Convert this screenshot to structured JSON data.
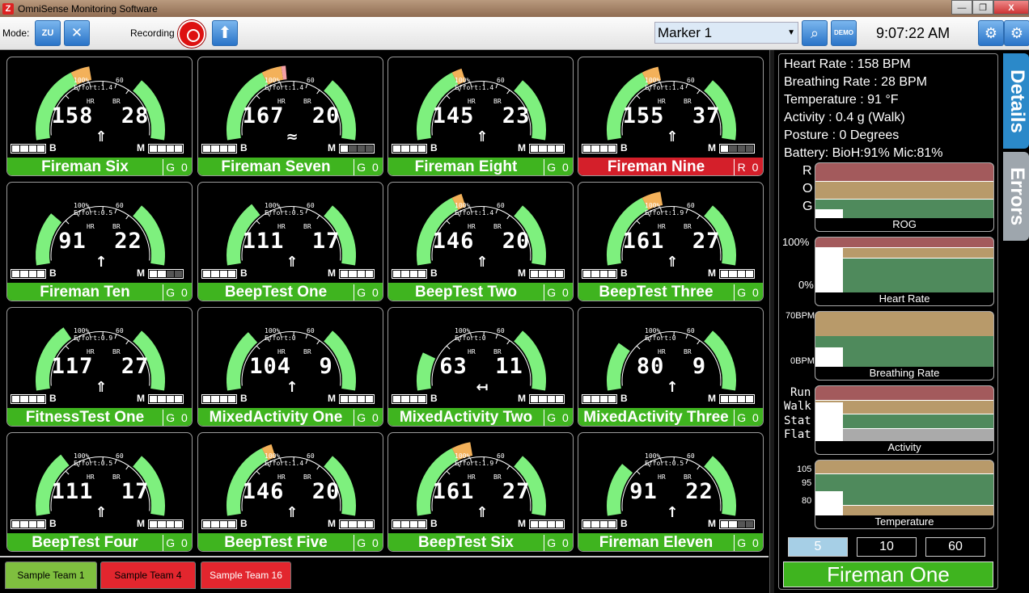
{
  "window": {
    "title": "OmniSense Monitoring Software",
    "buttons": [
      "—",
      "❐",
      "X"
    ]
  },
  "toolbar": {
    "mode_label": "Mode:",
    "recording_label": "Recording",
    "marker": "Marker 1",
    "clock": "9:07:22 AM",
    "demo_label": "DEMO",
    "mode_icon_label": "ZU"
  },
  "cards": [
    {
      "name": "Fireman Six",
      "hr": "158",
      "br": "28",
      "effort": "Effort:1.4",
      "status": "G 0",
      "footer": "green",
      "bio_batt": 4,
      "mic_batt": 4,
      "hr_level": 0.9,
      "activity": "walk"
    },
    {
      "name": "Fireman Seven",
      "hr": "167",
      "br": "20",
      "effort": "Effort:1.4",
      "status": "G 0",
      "footer": "green",
      "bio_batt": 4,
      "mic_batt": 1,
      "hr_level": 0.95,
      "activity": "run"
    },
    {
      "name": "Fireman Eight",
      "hr": "145",
      "br": "23",
      "effort": "Effort:1.4",
      "status": "G 0",
      "footer": "green",
      "bio_batt": 4,
      "mic_batt": 4,
      "hr_level": 0.82,
      "activity": "walk"
    },
    {
      "name": "Fireman Nine",
      "hr": "155",
      "br": "37",
      "effort": "Effort:1.4",
      "status": "R 0",
      "footer": "red",
      "bio_batt": 4,
      "mic_batt": 1,
      "hr_level": 0.88,
      "activity": "walk"
    },
    {
      "name": "Fireman Ten",
      "hr": "91",
      "br": "22",
      "effort": "Effort:0.5",
      "status": "G 0",
      "footer": "green",
      "bio_batt": 4,
      "mic_batt": 2,
      "hr_level": 0.5,
      "activity": "stand"
    },
    {
      "name": "BeepTest One",
      "hr": "111",
      "br": "17",
      "effort": "Effort:0.5",
      "status": "G 0",
      "footer": "green",
      "bio_batt": 4,
      "mic_batt": 4,
      "hr_level": 0.62,
      "activity": "walk"
    },
    {
      "name": "BeepTest Two",
      "hr": "146",
      "br": "20",
      "effort": "Effort:1.4",
      "status": "G 0",
      "footer": "green",
      "bio_batt": 4,
      "mic_batt": 4,
      "hr_level": 0.82,
      "activity": "walk"
    },
    {
      "name": "BeepTest Three",
      "hr": "161",
      "br": "27",
      "effort": "Effort:1.9",
      "status": "G 0",
      "footer": "green",
      "bio_batt": 4,
      "mic_batt": 4,
      "hr_level": 0.9,
      "activity": "walk"
    },
    {
      "name": "FitnessTest One",
      "hr": "117",
      "br": "27",
      "effort": "Effort:0.9",
      "status": "G 0",
      "footer": "green",
      "bio_batt": 4,
      "mic_batt": 4,
      "hr_level": 0.65,
      "activity": "walk"
    },
    {
      "name": "MixedActivity One",
      "hr": "104",
      "br": "9",
      "effort": "Effort:0",
      "status": "G 0",
      "footer": "green",
      "bio_batt": 4,
      "mic_batt": 4,
      "hr_level": 0.58,
      "activity": "stand"
    },
    {
      "name": "MixedActivity Two",
      "hr": "63",
      "br": "11",
      "effort": "Effort:0",
      "status": "G 0",
      "footer": "green",
      "bio_batt": 4,
      "mic_batt": 4,
      "hr_level": 0.35,
      "activity": "lie"
    },
    {
      "name": "MixedActivity Three",
      "hr": "80",
      "br": "9",
      "effort": "Effort:0",
      "status": "G 0",
      "footer": "green",
      "bio_batt": 4,
      "mic_batt": 4,
      "hr_level": 0.45,
      "activity": "stand"
    },
    {
      "name": "BeepTest Four",
      "hr": "111",
      "br": "17",
      "effort": "Effort:0.5",
      "status": "G 0",
      "footer": "green",
      "bio_batt": 4,
      "mic_batt": 4,
      "hr_level": 0.62,
      "activity": "walk"
    },
    {
      "name": "BeepTest Five",
      "hr": "146",
      "br": "20",
      "effort": "Effort:1.4",
      "status": "G 0",
      "footer": "green",
      "bio_batt": 4,
      "mic_batt": 4,
      "hr_level": 0.82,
      "activity": "walk"
    },
    {
      "name": "BeepTest Six",
      "hr": "161",
      "br": "27",
      "effort": "Effort:1.9",
      "status": "G 0",
      "footer": "green",
      "bio_batt": 4,
      "mic_batt": 4,
      "hr_level": 0.9,
      "activity": "walk"
    },
    {
      "name": "Fireman Eleven",
      "hr": "91",
      "br": "22",
      "effort": "Effort:0.5",
      "status": "G 0",
      "footer": "green",
      "bio_batt": 4,
      "mic_batt": 2,
      "hr_level": 0.5,
      "activity": "stand"
    }
  ],
  "gauge_labels": {
    "pct": "100%",
    "br_max": "60",
    "hr": "HR",
    "br": "BR",
    "bio": "B",
    "mic": "M"
  },
  "tabs": [
    {
      "label": "Sample Team 1",
      "color": "#7fbf3f",
      "text": "#000000"
    },
    {
      "label": "Sample Team 4",
      "color": "#e2262e",
      "text": "#000000"
    },
    {
      "label": "Sample Team 16",
      "color": "#e2262e",
      "text": "#ffffff"
    }
  ],
  "details": {
    "lines": [
      "Heart Rate : 158 BPM",
      "Breathing Rate : 28 BPM",
      "Temperature : 91 °F",
      "Activity : 0.4 g (Walk)",
      "Posture : 0 Degrees",
      "Battery: BioH:91% Mic:81%"
    ],
    "rog_axis": [
      "R",
      "O",
      "G"
    ],
    "rog_label": "ROG",
    "hr_axis": [
      "100%",
      "0%"
    ],
    "hr_label": "Heart Rate",
    "br_axis": [
      "70BPM",
      "0BPM"
    ],
    "br_label": "Breathing Rate",
    "act_axis": [
      "Run",
      "Walk",
      "Stat",
      "Flat"
    ],
    "act_label": "Activity",
    "temp_axis": [
      "105",
      "95",
      "80"
    ],
    "temp_label": "Temperature",
    "time_buttons": [
      "5",
      "10",
      "60"
    ],
    "selected_name": "Fireman One"
  },
  "side_tabs": [
    "Details",
    "Errors"
  ],
  "colors": {
    "green": "#3fb41f",
    "red": "#d41f2a",
    "gauge_green": "#7ef07e",
    "gauge_orange": "#f3b15a",
    "gauge_pink": "#f5a0a8"
  }
}
